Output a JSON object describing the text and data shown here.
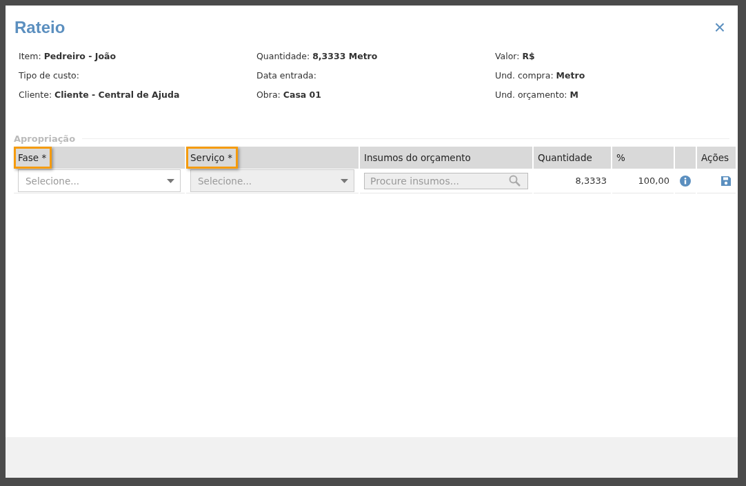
{
  "dialog": {
    "title": "Rateio",
    "close": "×"
  },
  "details": [
    {
      "label": "Item:",
      "value": "Pedreiro - João"
    },
    {
      "label": "Quantidade:",
      "value": "8,3333 Metro"
    },
    {
      "label": "Valor:",
      "value": "R$"
    },
    {
      "label": "Tipo de custo:"
    },
    {
      "label": "Data entrada:"
    },
    {
      "label": "Und. compra:",
      "value": "Metro"
    },
    {
      "label": "Cliente:",
      "value": "Cliente - Central de Ajuda"
    },
    {
      "label": "Obra:",
      "value": "Casa 01"
    },
    {
      "label": "Und. orçamento:",
      "value": "M"
    }
  ],
  "section_title": "Apropriação",
  "table": {
    "columns": [
      {
        "label": "Fase *",
        "highlighted": true
      },
      {
        "label": "Serviço *",
        "highlighted": true
      },
      {
        "label": "Insumos do orçamento",
        "highlighted": false
      },
      {
        "label": "Quantidade",
        "highlighted": false
      },
      {
        "label": "%",
        "highlighted": false
      },
      {
        "highlighted": false
      },
      {
        "label": "Ações",
        "highlighted": false
      }
    ],
    "rows": [
      {
        "cells": [
          {
            "kind": "select",
            "placeholder": "Selecione...",
            "disabled": false
          },
          {
            "kind": "select",
            "placeholder": "Selecione...",
            "disabled": true
          },
          {
            "kind": "search",
            "placeholder": "Procure insumos..."
          },
          {
            "kind": "number",
            "text": "8,3333"
          },
          {
            "kind": "number",
            "text": "100,00"
          },
          {
            "kind": "info"
          },
          {
            "kind": "save"
          }
        ]
      }
    ]
  }
}
